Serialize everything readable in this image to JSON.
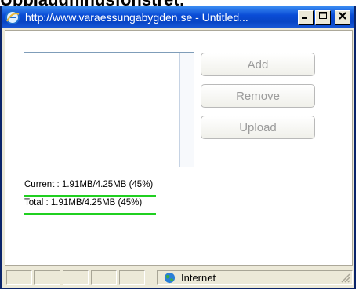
{
  "page_heading": "Uppladdningsfönstret:",
  "window": {
    "title": "http://www.varaessungabygden.se - Untitled..."
  },
  "buttons": {
    "add": "Add",
    "remove": "Remove",
    "upload": "Upload"
  },
  "progress": {
    "current_text": "Current : 1.91MB/4.25MB (45%)",
    "total_text": "Total : 1.91MB/4.25MB (45%)",
    "current_fraction": 0.45,
    "total_fraction": 0.45
  },
  "statusbar": {
    "zone": "Internet"
  },
  "colors": {
    "titlebar": "#0a4cd6",
    "progress_line": "#20d020",
    "disabled_text": "#9b9b9b"
  },
  "icons": [
    "ie-icon",
    "minimize-icon",
    "maximize-icon",
    "close-icon",
    "globe-icon",
    "resize-grip-icon"
  ]
}
